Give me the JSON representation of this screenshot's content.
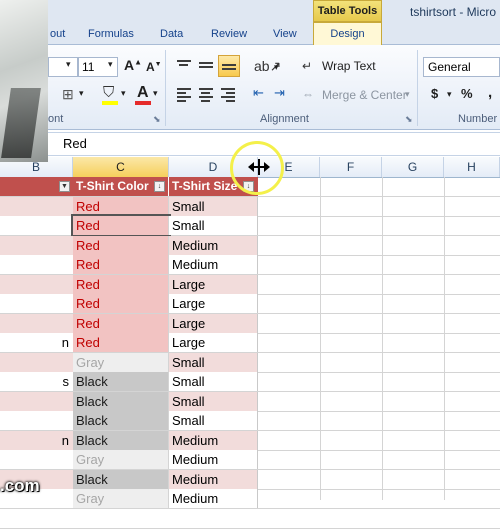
{
  "title_bar": {
    "context_header": "Table Tools",
    "filename": "tshirtsort - Micro"
  },
  "tabs": [
    "out",
    "Formulas",
    "Data",
    "Review",
    "View",
    "Design"
  ],
  "ribbon": {
    "font_size": "11",
    "font_group_label": "ont",
    "alignment_group_label": "Alignment",
    "wrap_text": "Wrap Text",
    "merge_center": "Merge & Center",
    "number_format": "General",
    "number_group_label": "Number",
    "currency_symbol": "$",
    "percent_symbol": "%",
    "comma_symbol": ","
  },
  "formula_bar": {
    "value": "Red"
  },
  "columns": [
    "B",
    "C",
    "D",
    "E",
    "F",
    "G",
    "H"
  ],
  "table": {
    "headers": {
      "color": "T-Shirt Color",
      "size": "T-Shirt Size"
    },
    "col_b": [
      "",
      "",
      "",
      "",
      "",
      "",
      "",
      "n",
      "",
      "s",
      "",
      "",
      "n",
      "",
      ""
    ],
    "rows": [
      {
        "color": "Red",
        "size": "Small"
      },
      {
        "color": "Red",
        "size": "Small"
      },
      {
        "color": "Red",
        "size": "Medium"
      },
      {
        "color": "Red",
        "size": "Medium"
      },
      {
        "color": "Red",
        "size": "Large"
      },
      {
        "color": "Red",
        "size": "Large"
      },
      {
        "color": "Red",
        "size": "Large"
      },
      {
        "color": "Red",
        "size": "Large"
      },
      {
        "color": "Gray",
        "size": "Small"
      },
      {
        "color": "Black",
        "size": "Small"
      },
      {
        "color": "Black",
        "size": "Small"
      },
      {
        "color": "Black",
        "size": "Small"
      },
      {
        "color": "Black",
        "size": "Medium"
      },
      {
        "color": "Gray",
        "size": "Medium"
      },
      {
        "color": "Black",
        "size": "Medium"
      },
      {
        "color": "Gray",
        "size": "Medium"
      }
    ]
  },
  "watermark": ".com",
  "colors": {
    "table_header": "#c0504d",
    "red_fill": "#f2c3c2",
    "gray_fill": "#eeeeee",
    "black_fill": "#c8c8c8",
    "accent_ring": "#f4f04a"
  }
}
